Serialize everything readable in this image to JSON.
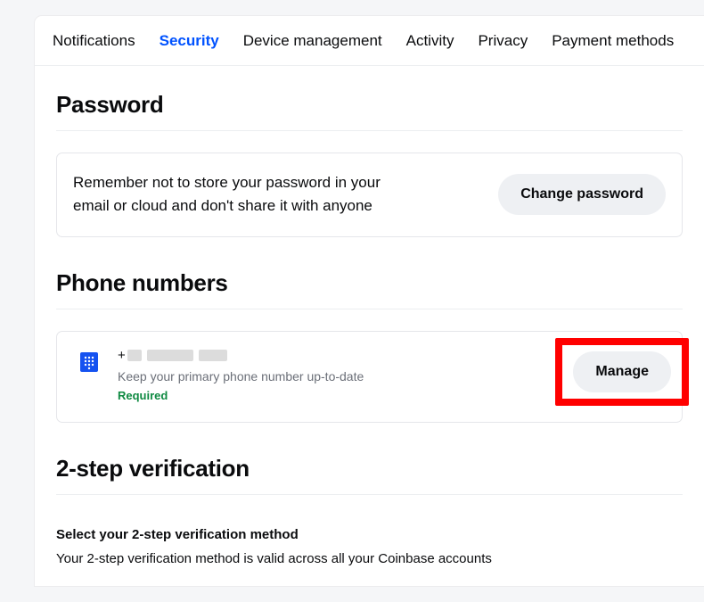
{
  "tabs": {
    "notifications": "Notifications",
    "security": "Security",
    "device": "Device management",
    "activity": "Activity",
    "privacy": "Privacy",
    "payment": "Payment methods"
  },
  "password": {
    "title": "Password",
    "message": "Remember not to store your password in your email or cloud and don't share it with anyone",
    "button": "Change password"
  },
  "phone": {
    "title": "Phone numbers",
    "prefix": "+",
    "desc": "Keep your primary phone number up-to-date",
    "required": "Required",
    "manage": "Manage"
  },
  "twostep": {
    "title": "2-step verification",
    "sub": "Select your 2-step verification method",
    "desc": "Your 2-step verification method is valid across all your Coinbase accounts"
  }
}
